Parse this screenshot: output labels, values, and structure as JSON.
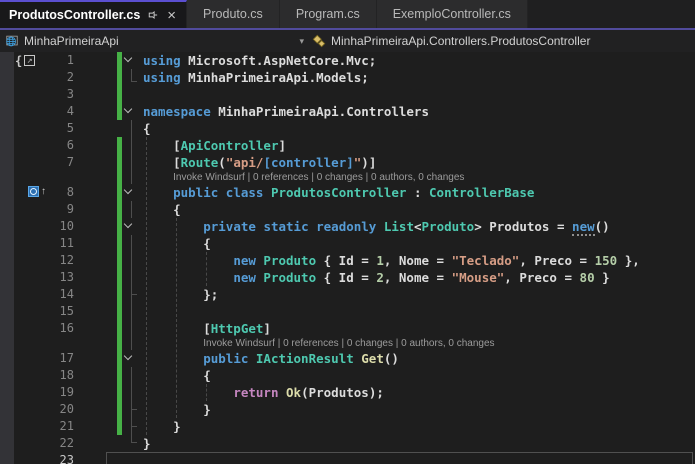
{
  "tabs": [
    {
      "label": "ProdutosController.cs",
      "active": true
    },
    {
      "label": "Produto.cs",
      "active": false
    },
    {
      "label": "Program.cs",
      "active": false
    },
    {
      "label": "ExemploController.cs",
      "active": false
    }
  ],
  "breadcrumb": {
    "project": "MinhaPrimeiraApi",
    "symbol_path": "MinhaPrimeiraApi.Controllers.ProdutosController"
  },
  "colors": {
    "accent": "#5B4FD1",
    "accentdim": "#514B9C",
    "chg": "#46B146",
    "kw": "#569CD6",
    "ctrl": "#C586C0",
    "type": "#4EC9B0",
    "method": "#DCDCAA",
    "str": "#D69D85",
    "num": "#B5CEA8",
    "pl": "#DCDCDC",
    "lens": "#9C9C9C",
    "lnum": "#868686"
  },
  "editor": {
    "codelens_text": "Invoke Windsurf | 0 references | 0 changes | 0 authors, 0 changes",
    "rows": [
      {
        "n": 1,
        "chev": true,
        "chg": true,
        "icon": "brace",
        "tokens": [
          [
            "kw",
            "using"
          ],
          [
            "pl",
            " Microsoft.AspNetCore.Mvc;"
          ]
        ]
      },
      {
        "n": 2,
        "chg": true,
        "tokens": [
          [
            "kw",
            "using"
          ],
          [
            "pl",
            " MinhaPrimeiraApi.Models;"
          ]
        ]
      },
      {
        "n": 3,
        "chg": true,
        "tokens": []
      },
      {
        "n": 4,
        "chev": true,
        "chg": true,
        "tokens": [
          [
            "kw",
            "namespace"
          ],
          [
            "pl",
            " MinhaPrimeiraApi.Controllers"
          ]
        ]
      },
      {
        "n": 5,
        "tokens": [
          [
            "pl",
            "{"
          ]
        ]
      },
      {
        "n": 6,
        "chg": true,
        "tokens": [
          [
            "pl",
            "    ["
          ],
          [
            "type",
            "ApiController"
          ],
          [
            "pl",
            "]"
          ]
        ]
      },
      {
        "n": 7,
        "chg": true,
        "tokens": [
          [
            "pl",
            "    ["
          ],
          [
            "type",
            "Route"
          ],
          [
            "pl",
            "("
          ],
          [
            "str",
            "\"api/"
          ],
          [
            "strkw",
            "[controller]"
          ],
          [
            "str",
            "\""
          ],
          [
            "pl",
            ")]"
          ]
        ]
      },
      {
        "codelens": true,
        "chg": true,
        "indent": 4
      },
      {
        "n": 8,
        "chev": true,
        "chg": true,
        "icon": "ref",
        "tokens": [
          [
            "pl",
            "    "
          ],
          [
            "kw",
            "public"
          ],
          [
            "pl",
            " "
          ],
          [
            "kw",
            "class"
          ],
          [
            "pl",
            " "
          ],
          [
            "type",
            "ProdutosController"
          ],
          [
            "pl",
            " : "
          ],
          [
            "type",
            "ControllerBase"
          ]
        ]
      },
      {
        "n": 9,
        "chg": true,
        "tokens": [
          [
            "pl",
            "    {"
          ]
        ]
      },
      {
        "n": 10,
        "chev": true,
        "chg": true,
        "tokens": [
          [
            "pl",
            "        "
          ],
          [
            "kw",
            "private"
          ],
          [
            "pl",
            " "
          ],
          [
            "kw",
            "static"
          ],
          [
            "pl",
            " "
          ],
          [
            "kw",
            "readonly"
          ],
          [
            "pl",
            " "
          ],
          [
            "type",
            "List"
          ],
          [
            "pl",
            "<"
          ],
          [
            "type",
            "Produto"
          ],
          [
            "pl",
            "> Produtos = "
          ],
          [
            "kwdots",
            "new"
          ],
          [
            "pl",
            "()"
          ]
        ]
      },
      {
        "n": 11,
        "chg": true,
        "tokens": [
          [
            "pl",
            "        {"
          ]
        ]
      },
      {
        "n": 12,
        "chg": true,
        "tokens": [
          [
            "pl",
            "            "
          ],
          [
            "kw",
            "new"
          ],
          [
            "pl",
            " "
          ],
          [
            "type",
            "Produto"
          ],
          [
            "pl",
            " { Id = "
          ],
          [
            "num",
            "1"
          ],
          [
            "pl",
            ", Nome = "
          ],
          [
            "str",
            "\"Teclado\""
          ],
          [
            "pl",
            ", Preco = "
          ],
          [
            "num",
            "150"
          ],
          [
            "pl",
            " },"
          ]
        ]
      },
      {
        "n": 13,
        "chg": true,
        "tokens": [
          [
            "pl",
            "            "
          ],
          [
            "kw",
            "new"
          ],
          [
            "pl",
            " "
          ],
          [
            "type",
            "Produto"
          ],
          [
            "pl",
            " { Id = "
          ],
          [
            "num",
            "2"
          ],
          [
            "pl",
            ", Nome = "
          ],
          [
            "str",
            "\"Mouse\""
          ],
          [
            "pl",
            ", Preco = "
          ],
          [
            "num",
            "80"
          ],
          [
            "pl",
            " }"
          ]
        ]
      },
      {
        "n": 14,
        "chg": true,
        "tokens": [
          [
            "pl",
            "        };"
          ]
        ]
      },
      {
        "n": 15,
        "chg": true,
        "tokens": []
      },
      {
        "n": 16,
        "chg": true,
        "tokens": [
          [
            "pl",
            "        ["
          ],
          [
            "type",
            "HttpGet"
          ],
          [
            "pl",
            "]"
          ]
        ]
      },
      {
        "codelens": true,
        "chg": true,
        "indent": 8
      },
      {
        "n": 17,
        "chev": true,
        "chg": true,
        "tokens": [
          [
            "pl",
            "        "
          ],
          [
            "kw",
            "public"
          ],
          [
            "pl",
            " "
          ],
          [
            "type",
            "IActionResult"
          ],
          [
            "pl",
            " "
          ],
          [
            "method",
            "Get"
          ],
          [
            "pl",
            "()"
          ]
        ]
      },
      {
        "n": 18,
        "chg": true,
        "tokens": [
          [
            "pl",
            "        {"
          ]
        ]
      },
      {
        "n": 19,
        "chg": true,
        "tokens": [
          [
            "pl",
            "            "
          ],
          [
            "ctrl",
            "return"
          ],
          [
            "pl",
            " "
          ],
          [
            "method",
            "Ok"
          ],
          [
            "pl",
            "("
          ],
          [
            "pl",
            "Produtos"
          ],
          [
            "pl",
            ");"
          ]
        ]
      },
      {
        "n": 20,
        "chg": true,
        "tokens": [
          [
            "pl",
            "        }"
          ]
        ]
      },
      {
        "n": 21,
        "chg": true,
        "tokens": [
          [
            "pl",
            "    }"
          ]
        ]
      },
      {
        "n": 22,
        "tokens": [
          [
            "pl",
            "}"
          ]
        ]
      },
      {
        "n": 23,
        "current": true,
        "tokens": []
      }
    ]
  }
}
